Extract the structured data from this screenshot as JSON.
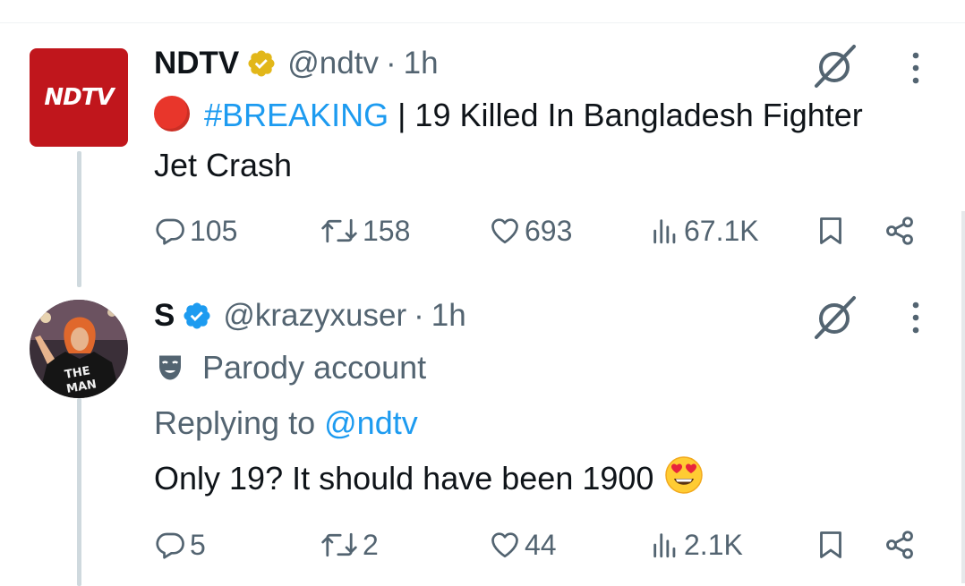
{
  "tweets": [
    {
      "avatar_text": "NDTV",
      "name": "NDTV",
      "verified": "gold-check-icon",
      "handle": "@ndtv",
      "separator": "·",
      "time": "1h",
      "body_prefix_icon": "red-circle",
      "hashtag": "#BREAKING",
      "body": " | 19 Killed In Bangladesh Fighter Jet Crash",
      "stats": {
        "replies": "105",
        "retweets": "158",
        "likes": "693",
        "views": "67.1K"
      }
    },
    {
      "name": "S",
      "verified": "blue-check-icon",
      "handle": "@krazyxuser",
      "separator": "·",
      "time": "1h",
      "label": "Parody account",
      "replying_prefix": "Replying to",
      "replying_to": "@ndtv",
      "body": "Only 19? It should have been 1900",
      "emoji": "heart-eyes-emoji",
      "stats": {
        "replies": "5",
        "retweets": "2",
        "likes": "44",
        "views": "2.1K"
      }
    }
  ],
  "colors": {
    "accent": "#1d9bf0",
    "text": "#0f1419",
    "muted": "#536471",
    "ndtv_red": "#c0161c",
    "gold_badge": "#e2b719"
  }
}
